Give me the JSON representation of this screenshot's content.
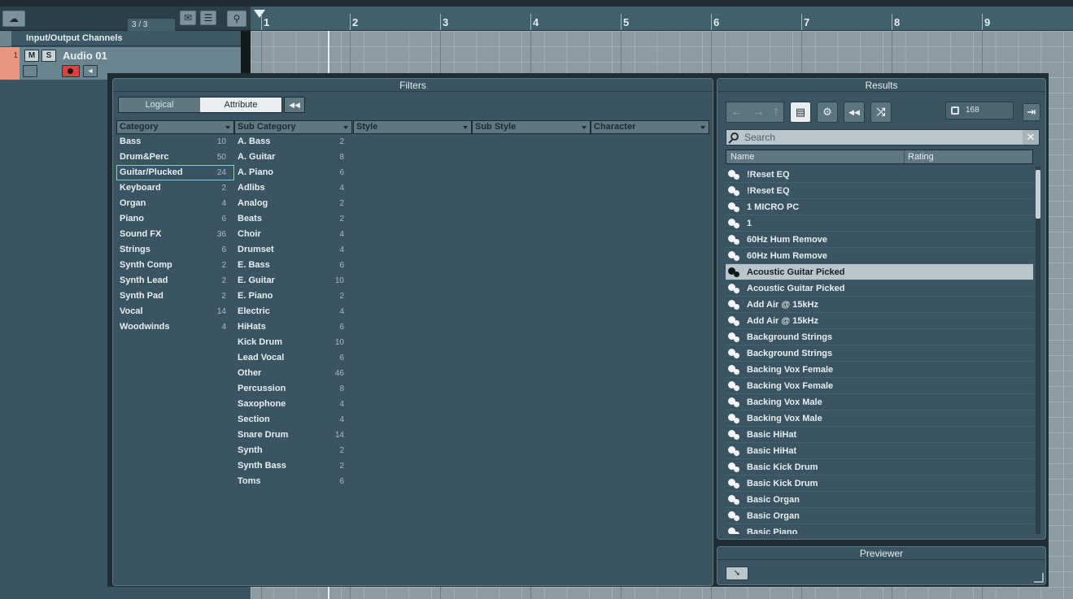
{
  "toolbar": {
    "track_counter": "3 / 3"
  },
  "ruler": {
    "bars": [
      "1",
      "2",
      "3",
      "4",
      "5",
      "6",
      "7",
      "8",
      "9"
    ]
  },
  "tracks": {
    "folder_title": "Input/Output Channels",
    "audio": {
      "number": "1",
      "name": "Audio 01",
      "mute_label": "M",
      "solo_label": "S"
    }
  },
  "filters": {
    "title": "Filters",
    "tabs": {
      "logical": "Logical",
      "attribute": "Attribute"
    },
    "columns": {
      "category": "Category",
      "subcategory": "Sub Category",
      "style": "Style",
      "substyle": "Sub Style",
      "character": "Character"
    },
    "category_items": [
      {
        "label": "Bass",
        "count": "10"
      },
      {
        "label": "Drum&Perc",
        "count": "50"
      },
      {
        "label": "Guitar/Plucked",
        "count": "24"
      },
      {
        "label": "Keyboard",
        "count": "2"
      },
      {
        "label": "Organ",
        "count": "4"
      },
      {
        "label": "Piano",
        "count": "6"
      },
      {
        "label": "Sound FX",
        "count": "36"
      },
      {
        "label": "Strings",
        "count": "6"
      },
      {
        "label": "Synth Comp",
        "count": "2"
      },
      {
        "label": "Synth Lead",
        "count": "2"
      },
      {
        "label": "Synth Pad",
        "count": "2"
      },
      {
        "label": "Vocal",
        "count": "14"
      },
      {
        "label": "Woodwinds",
        "count": "4"
      }
    ],
    "subcategory_items": [
      {
        "label": "A. Bass",
        "count": "2"
      },
      {
        "label": "A. Guitar",
        "count": "8"
      },
      {
        "label": "A. Piano",
        "count": "6"
      },
      {
        "label": "Adlibs",
        "count": "4"
      },
      {
        "label": "Analog",
        "count": "2"
      },
      {
        "label": "Beats",
        "count": "2"
      },
      {
        "label": "Choir",
        "count": "4"
      },
      {
        "label": "Drumset",
        "count": "4"
      },
      {
        "label": "E. Bass",
        "count": "6"
      },
      {
        "label": "E. Guitar",
        "count": "10"
      },
      {
        "label": "E. Piano",
        "count": "2"
      },
      {
        "label": "Electric",
        "count": "4"
      },
      {
        "label": "HiHats",
        "count": "6"
      },
      {
        "label": "Kick Drum",
        "count": "10"
      },
      {
        "label": "Lead Vocal",
        "count": "6"
      },
      {
        "label": "Other",
        "count": "46"
      },
      {
        "label": "Percussion",
        "count": "8"
      },
      {
        "label": "Saxophone",
        "count": "4"
      },
      {
        "label": "Section",
        "count": "4"
      },
      {
        "label": "Snare Drum",
        "count": "14"
      },
      {
        "label": "Synth",
        "count": "2"
      },
      {
        "label": "Synth Bass",
        "count": "2"
      },
      {
        "label": "Toms",
        "count": "6"
      }
    ]
  },
  "results": {
    "title": "Results",
    "count": "168",
    "search_placeholder": "Search",
    "columns": {
      "name": "Name",
      "rating": "Rating"
    },
    "items": [
      "!Reset EQ",
      "!Reset EQ",
      "1 MICRO PC",
      "1",
      "60Hz Hum Remove",
      "60Hz Hum Remove",
      "Acoustic Guitar Picked",
      "Acoustic Guitar Picked",
      "Add Air @ 15kHz",
      "Add Air @ 15kHz",
      "Background Strings",
      "Background Strings",
      "Backing Vox Female",
      "Backing Vox Female",
      "Backing Vox Male",
      "Backing Vox Male",
      "Basic HiHat",
      "Basic HiHat",
      "Basic Kick Drum",
      "Basic Kick Drum",
      "Basic Organ",
      "Basic Organ",
      "Basic Piano"
    ],
    "selected_index": 6
  },
  "previewer": {
    "title": "Previewer"
  },
  "colors": {
    "accent_selection": "#7fe06a",
    "track_color": "#e8967e",
    "record": "#d7453e"
  }
}
